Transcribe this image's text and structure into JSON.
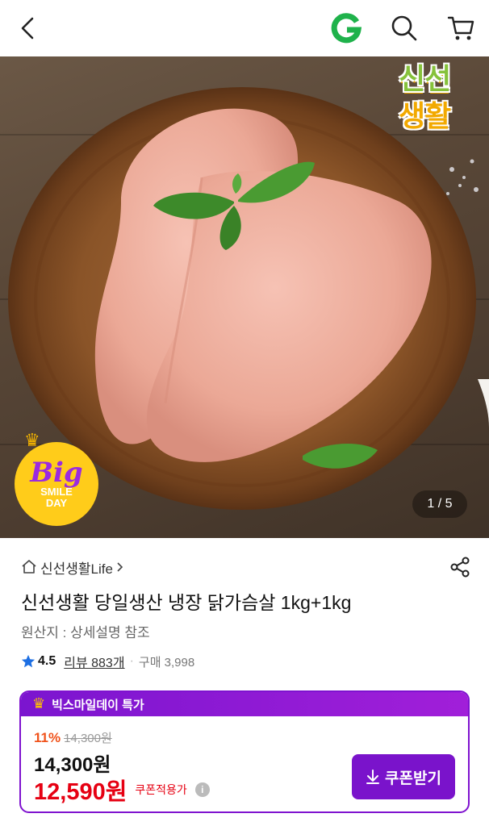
{
  "header": {
    "icons": [
      "back-arrow-icon",
      "g-logo-icon",
      "search-icon",
      "cart-icon"
    ],
    "logo_letter": "G",
    "logo_color": "#1fb24b"
  },
  "hero": {
    "brand_badge_line1": "신선",
    "brand_badge_line2": "생활",
    "event_badge": {
      "big": "Big",
      "smile": "SMILE",
      "day": "DAY"
    },
    "image_counter": "1 / 5"
  },
  "product": {
    "store_name": "신선생활Life",
    "title": "신선생활 당일생산 냉장 닭가슴살 1kg+1kg",
    "origin": "원산지 : 상세설명 참조",
    "rating": "4.5",
    "review_label": "리뷰 883개",
    "purchase_label": "구매 3,998"
  },
  "promo": {
    "header": "빅스마일데이 특가",
    "discount_rate": "11%",
    "original_price": "14,300원",
    "price": "14,300원",
    "coupon_price": "12,590원",
    "coupon_applied": "쿠폰적용가",
    "coupon_button": "쿠폰받기",
    "accent_color": "#7a13cb",
    "price_color": "#e60012"
  }
}
